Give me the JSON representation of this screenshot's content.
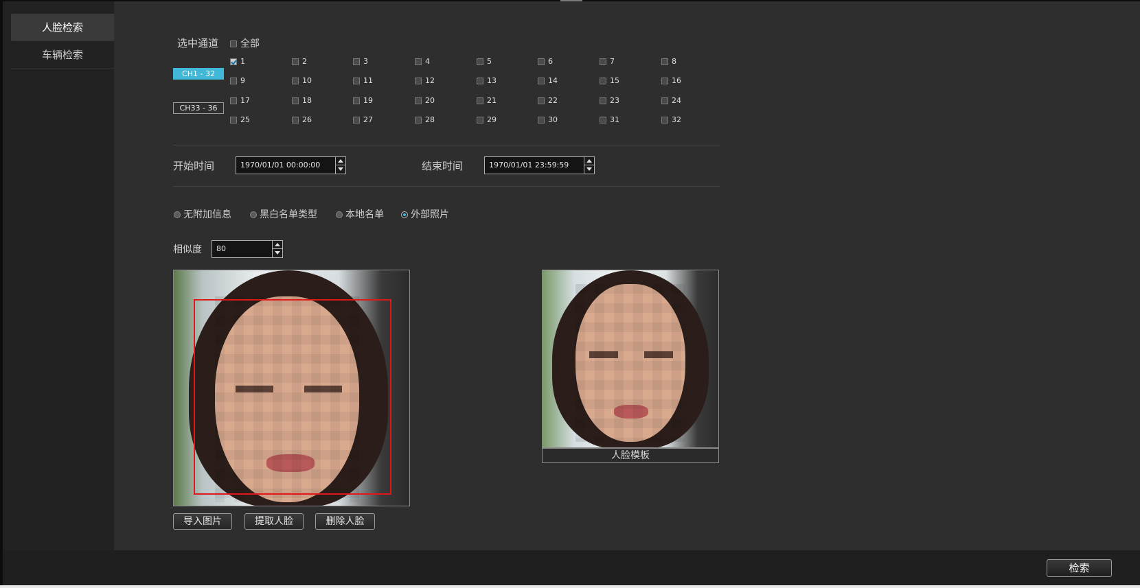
{
  "sidebar": {
    "items": [
      {
        "label": "人脸检索",
        "active": true
      },
      {
        "label": "车辆检索",
        "active": false
      }
    ]
  },
  "channels": {
    "label": "选中通道",
    "all_label": "全部",
    "all_checked": false,
    "ranges": [
      {
        "label": "CH1 - 32",
        "active": true
      },
      {
        "label": "CH33 - 36",
        "active": false
      }
    ],
    "items": [
      "1",
      "2",
      "3",
      "4",
      "5",
      "6",
      "7",
      "8",
      "9",
      "10",
      "11",
      "12",
      "13",
      "14",
      "15",
      "16",
      "17",
      "18",
      "19",
      "20",
      "21",
      "22",
      "23",
      "24",
      "25",
      "26",
      "27",
      "28",
      "29",
      "30",
      "31",
      "32"
    ],
    "checked": [
      "1"
    ]
  },
  "time": {
    "start_label": "开始时间",
    "start_value": "1970/01/01 00:00:00",
    "end_label": "结束时间",
    "end_value": "1970/01/01 23:59:59"
  },
  "info_type": {
    "options": [
      "无附加信息",
      "黑白名单类型",
      "本地名单",
      "外部照片"
    ],
    "selected": "外部照片"
  },
  "similarity": {
    "label": "相似度",
    "value": "80"
  },
  "photo_buttons": {
    "import": "导入图片",
    "extract": "提取人脸",
    "delete": "删除人脸"
  },
  "template": {
    "caption": "人脸模板"
  },
  "actions": {
    "search": "检索"
  },
  "colors": {
    "accent": "#41b8d8",
    "face_box": "#e01818",
    "panel": "#2e2e2e",
    "sidebar": "#222222"
  }
}
